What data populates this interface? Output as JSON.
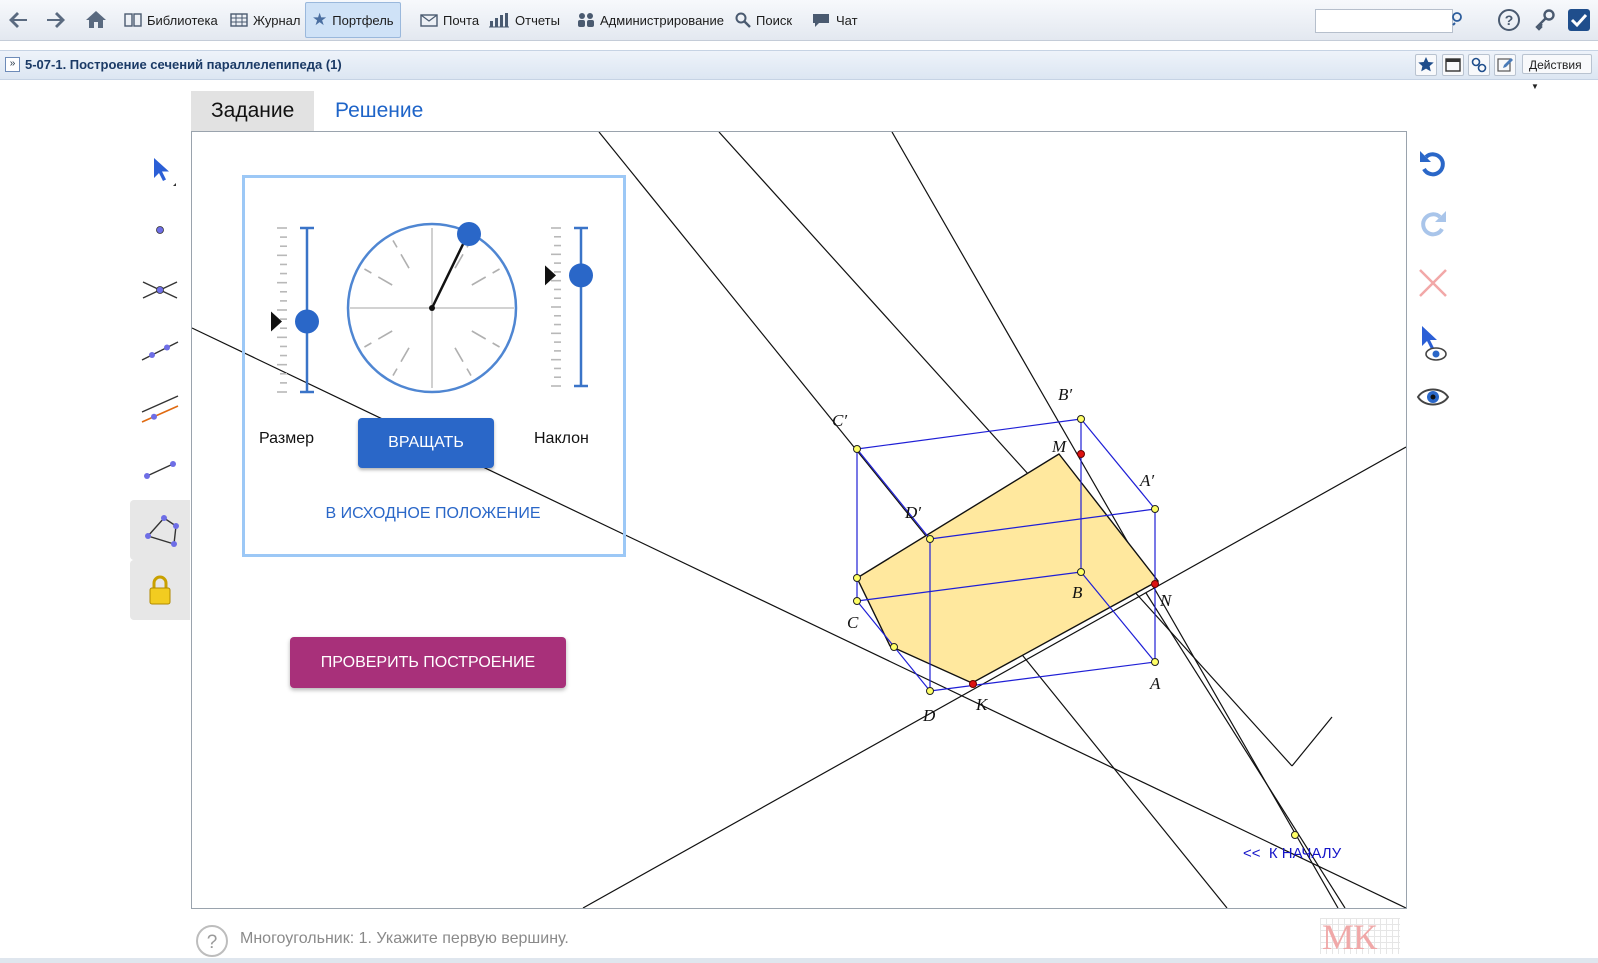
{
  "nav": {
    "library": "Библиотека",
    "journal": "Журнал",
    "portfolio": "Портфель",
    "mail": "Почта",
    "reports": "Отчеты",
    "admin": "Администрирование",
    "search": "Поиск",
    "chat": "Чат"
  },
  "search": {
    "placeholder": ""
  },
  "document": {
    "title": "5-07-1. Построение сечений параллелепипеда (1)",
    "actions_label": "Действия"
  },
  "tabs": {
    "task": "Задание",
    "solution": "Решение"
  },
  "controls": {
    "size_label": "Размер",
    "tilt_label": "Наклон",
    "rotate_button": "ВРАЩАТЬ",
    "reset_link": "В ИСХОДНОЕ ПОЛОЖЕНИЕ",
    "check_button": "ПРОВЕРИТЬ ПОСТРОЕНИЕ",
    "size_level": 0.43,
    "tilt_level": 0.7
  },
  "figure": {
    "labels": {
      "A": "A",
      "B": "B",
      "C": "C",
      "D": "D",
      "A1": "A′",
      "B1": "B′",
      "C1": "C′",
      "D1": "D′",
      "M": "M",
      "N": "N",
      "K": "K"
    }
  },
  "links": {
    "to_start": "<<  К НАЧАЛУ"
  },
  "status": {
    "text": "Многоугольник: 1. Укажите первую вершину."
  },
  "logo": {
    "text": "МК"
  },
  "colors": {
    "accent_blue": "#2a67c8",
    "check_purple": "#a8307a",
    "section_fill": "#ffe89e",
    "edge_blue": "#1f1fd6",
    "point_red": "#dd1111",
    "point_yellow": "#ffff66"
  }
}
